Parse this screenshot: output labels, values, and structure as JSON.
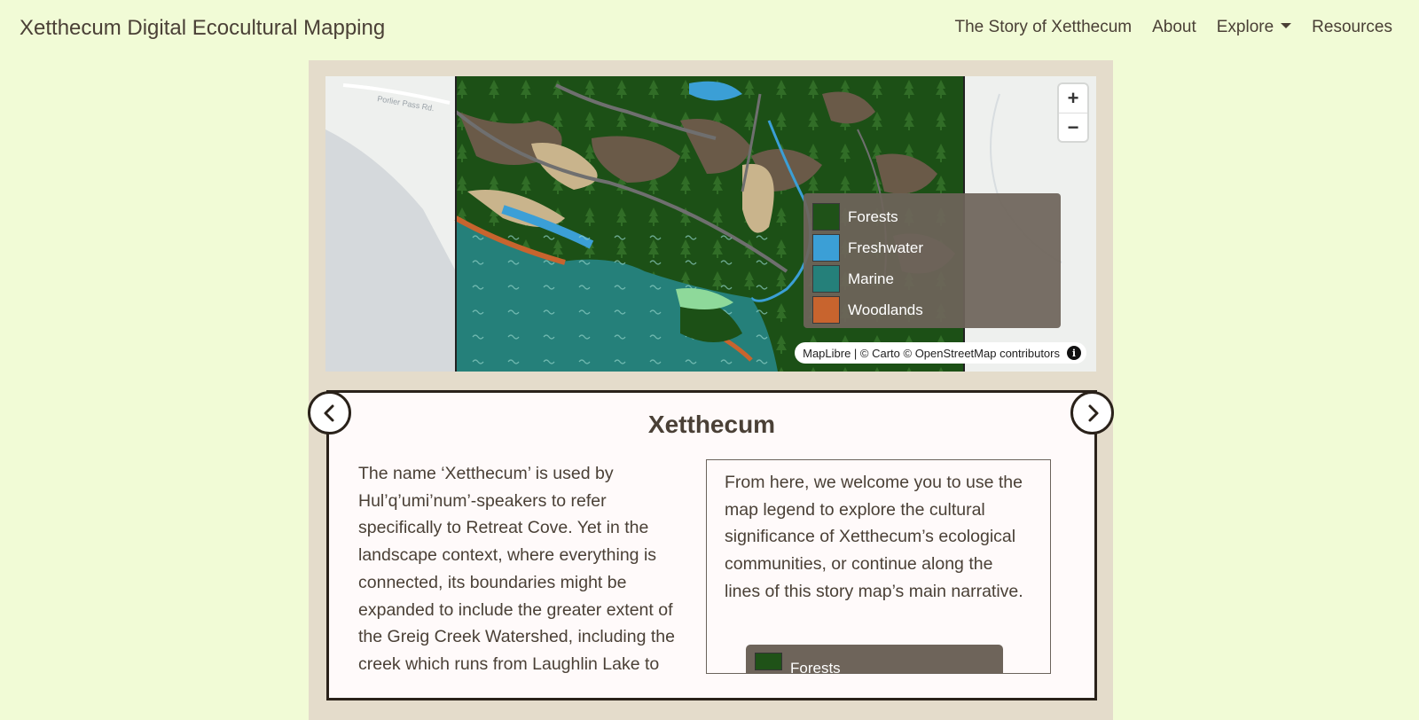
{
  "header": {
    "brand": "Xetthecum Digital Ecocultural Mapping",
    "nav": {
      "story": "The Story of Xetthecum",
      "about": "About",
      "explore": "Explore",
      "resources": "Resources"
    }
  },
  "map": {
    "road_label": "Porlier Pass Rd.",
    "zoom_in": "+",
    "zoom_out": "−",
    "legend": [
      {
        "label": "Forests",
        "color": "#1f5218"
      },
      {
        "label": "Freshwater",
        "color": "#3b9fd6"
      },
      {
        "label": "Marine",
        "color": "#25807a"
      },
      {
        "label": "Woodlands",
        "color": "#c8642e"
      }
    ],
    "attribution": "MapLibre | © Carto © OpenStreetMap contributors",
    "info": "i"
  },
  "story": {
    "title": "Xetthecum",
    "left_text": "The name ‘Xetthecum’ is used by Hul’q’umi’num’-speakers to refer specifically to Retreat Cove. Yet in the landscape context, where everything is connected, its boundaries might be expanded to include the greater extent of the Greig Creek Watershed, including the creek which runs from Laughlin Lake to",
    "right_text": "From here, we welcome you to use the map legend to explore the cultural significance of Xetthecum’s ecological communities, or continue along the lines of this story map’s main narrative.",
    "mini_legend_label": "Forests"
  },
  "colors": {
    "page_bg": "#f1fbd6",
    "frame_bg": "#e4dccb",
    "text": "#4a4036",
    "forest": "#1f5218",
    "freshwater": "#3b9fd6",
    "marine": "#25807a",
    "woodlands": "#c8642e"
  }
}
